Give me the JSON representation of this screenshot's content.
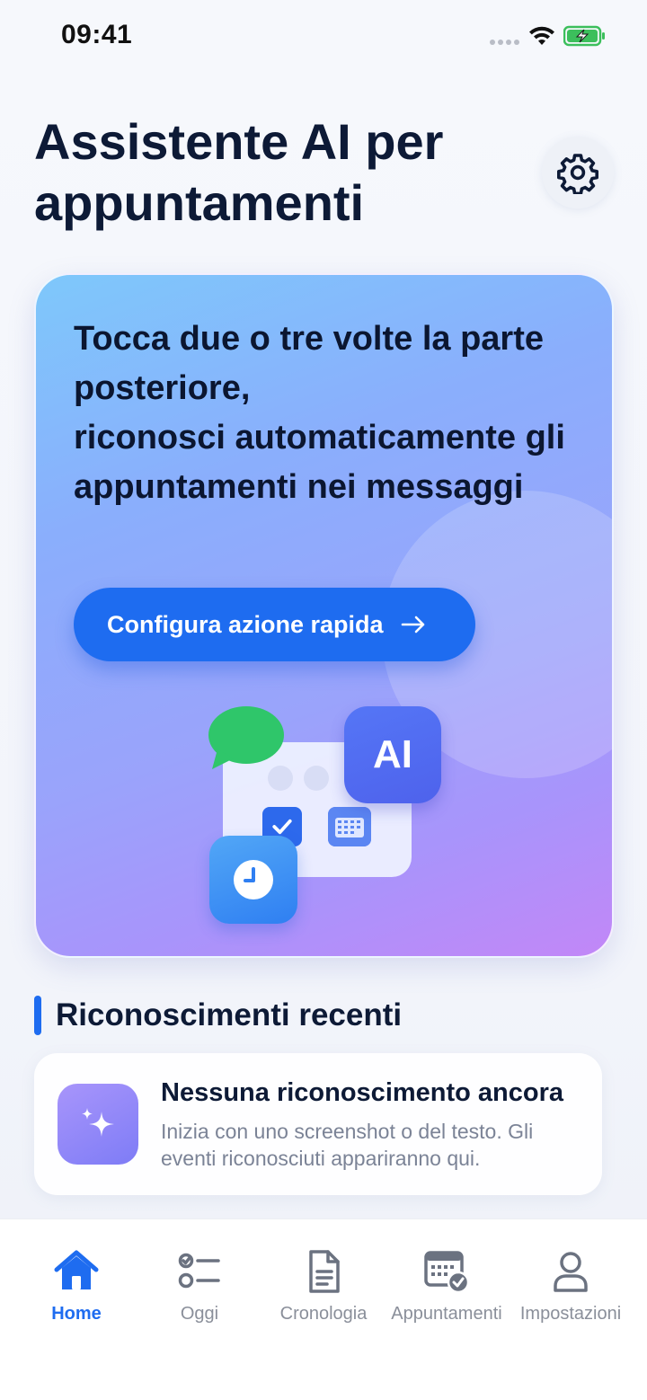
{
  "status_bar": {
    "time": "09:41"
  },
  "header": {
    "title": "Assistente AI per appuntamenti",
    "settings_icon": "gear-icon"
  },
  "hero": {
    "text": "Tocca due o tre volte la parte posteriore,\nriconosci automaticamente gli appuntamenti nei messaggi",
    "button_label": "Configura azione rapida",
    "ai_label": "AI",
    "gradient_colors": [
      "#7ec8fb",
      "#9aa3fb",
      "#c287f7"
    ],
    "accent": "#1e6cf0"
  },
  "recent": {
    "section_title": "Riconoscimenti recenti",
    "empty_title": "Nessuna riconoscimento ancora",
    "empty_description": "Inizia con uno screenshot o del testo. Gli eventi riconosciuti appariranno qui."
  },
  "tab_bar": {
    "active": "Home",
    "items": [
      {
        "label": "Home",
        "icon": "home-icon"
      },
      {
        "label": "Oggi",
        "icon": "checklist-icon"
      },
      {
        "label": "Cronologia",
        "icon": "document-icon"
      },
      {
        "label": "Appuntamenti",
        "icon": "calendar-check-icon"
      },
      {
        "label": "Impostazioni",
        "icon": "person-icon"
      }
    ]
  }
}
